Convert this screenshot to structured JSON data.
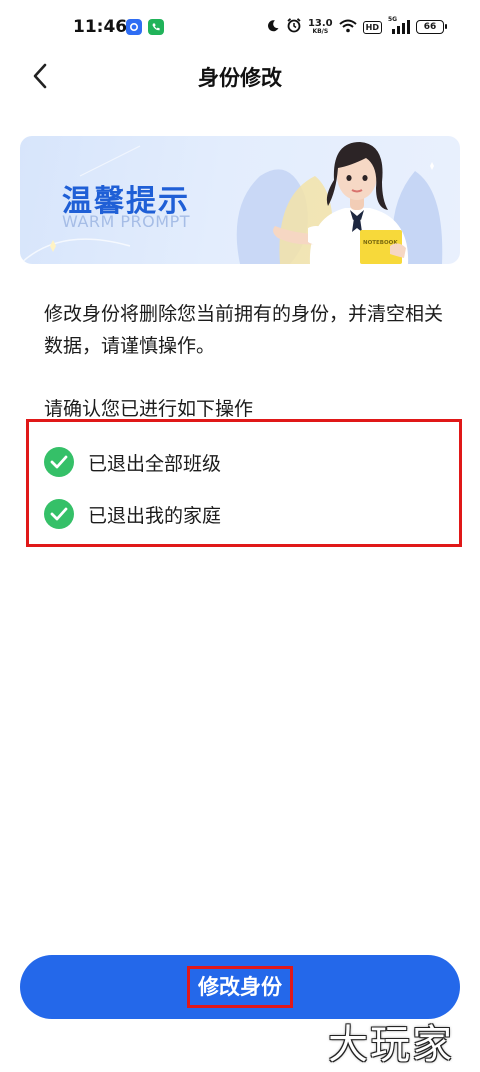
{
  "status_bar": {
    "time": "11:46",
    "net_speed_value": "13.0",
    "net_speed_unit": "KB/S",
    "hd_label": "HD",
    "signal_label": "5G",
    "battery_level": "66"
  },
  "header": {
    "title": "身份修改"
  },
  "banner": {
    "title": "温馨提示",
    "subtitle": "WARM PROMPT",
    "notebook_text": "NOTEBOOK"
  },
  "notice": {
    "text": "修改身份将删除您当前拥有的身份，并清空相关数据，请谨慎操作。"
  },
  "confirm": {
    "title": "请确认您已进行如下操作",
    "items": [
      {
        "label": "已退出全部班级",
        "checked": true
      },
      {
        "label": "已退出我的家庭",
        "checked": true
      }
    ]
  },
  "footer": {
    "button_label": "修改身份"
  },
  "watermark": "大玩家",
  "colors": {
    "primary": "#2468ea",
    "check_green": "#35c068",
    "highlight_red": "#e01818",
    "banner_title": "#1f5fd6"
  }
}
